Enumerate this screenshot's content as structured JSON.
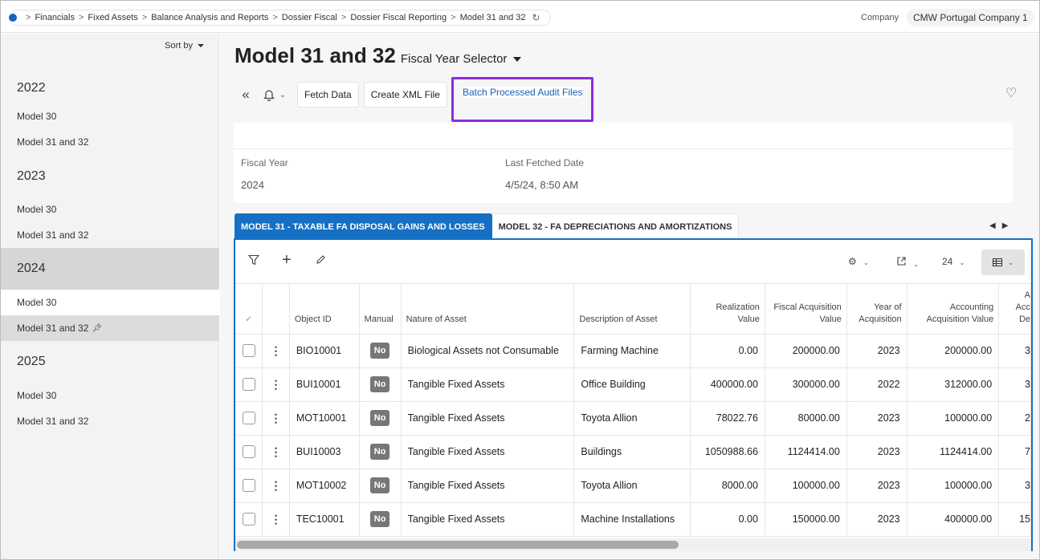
{
  "breadcrumb": {
    "items": [
      "Financials",
      "Fixed Assets",
      "Balance Analysis and Reports",
      "Dossier Fiscal",
      "Dossier Fiscal Reporting",
      "Model 31 and 32"
    ],
    "separator": ">"
  },
  "company": {
    "label": "Company",
    "value": "CMW Portugal Company 1"
  },
  "nav": {
    "sort_label": "Sort by",
    "groups": [
      {
        "year": "2022",
        "items": [
          "Model 30",
          "Model 31 and 32"
        ]
      },
      {
        "year": "2023",
        "items": [
          "Model 30",
          "Model 31 and 32"
        ]
      },
      {
        "year": "2024",
        "items": [
          "Model 30",
          "Model 31 and 32"
        ]
      },
      {
        "year": "2025",
        "items": [
          "Model 30",
          "Model 31 and 32"
        ]
      }
    ],
    "selected_group": "2024",
    "selected_item": "Model 31 and 32"
  },
  "page": {
    "title": "Model 31 and 32",
    "selector_label": "Fiscal Year Selector"
  },
  "toolbar": {
    "fetch_label": "Fetch Data",
    "create_xml_label": "Create XML File",
    "batch_label": "Batch Processed Audit Files"
  },
  "header_card": {
    "fiscal_year_label": "Fiscal Year",
    "fiscal_year_value": "2024",
    "last_fetched_label": "Last Fetched Date",
    "last_fetched_value": "4/5/24, 8:50 AM"
  },
  "tabs": [
    {
      "label": "MODEL 31 - TAXABLE FA DISPOSAL GAINS AND LOSSES",
      "active": true
    },
    {
      "label": "MODEL 32 - FA DEPRECIATIONS AND AMORTIZATIONS",
      "active": false
    }
  ],
  "grid_tools": {
    "page_size": "24"
  },
  "table": {
    "columns": {
      "object_id": "Object ID",
      "manual": "Manual",
      "nature": "Nature of Asset",
      "description": "Description of Asset",
      "realization_1": "Realization",
      "realization_2": "Value",
      "fiscal_acq_1": "Fiscal Acquisition",
      "fiscal_acq_2": "Value",
      "year_acq_1": "Year of",
      "year_acq_2": "Acquisition",
      "acc_acq_1": "Accounting",
      "acc_acq_2": "Acquisition Value",
      "partial_1": "A",
      "partial_2": "Acc",
      "partial_3": "De"
    },
    "rows": [
      {
        "object_id": "BIO10001",
        "manual": "No",
        "nature": "Biological Assets not Consumable",
        "description": "Farming Machine",
        "realization": "0.00",
        "fiscal_acq": "200000.00",
        "year": "2023",
        "acc_acq": "200000.00",
        "partial": "3"
      },
      {
        "object_id": "BUI10001",
        "manual": "No",
        "nature": "Tangible Fixed Assets",
        "description": "Office Building",
        "realization": "400000.00",
        "fiscal_acq": "300000.00",
        "year": "2022",
        "acc_acq": "312000.00",
        "partial": "3"
      },
      {
        "object_id": "MOT10001",
        "manual": "No",
        "nature": "Tangible Fixed Assets",
        "description": "Toyota Allion",
        "realization": "78022.76",
        "fiscal_acq": "80000.00",
        "year": "2023",
        "acc_acq": "100000.00",
        "partial": "2"
      },
      {
        "object_id": "BUI10003",
        "manual": "No",
        "nature": "Tangible Fixed Assets",
        "description": "Buildings",
        "realization": "1050988.66",
        "fiscal_acq": "1124414.00",
        "year": "2023",
        "acc_acq": "1124414.00",
        "partial": "7"
      },
      {
        "object_id": "MOT10002",
        "manual": "No",
        "nature": "Tangible Fixed Assets",
        "description": "Toyota Allion",
        "realization": "8000.00",
        "fiscal_acq": "100000.00",
        "year": "2023",
        "acc_acq": "100000.00",
        "partial": "3"
      },
      {
        "object_id": "TEC10001",
        "manual": "No",
        "nature": "Tangible Fixed Assets",
        "description": "Machine Installations",
        "realization": "0.00",
        "fiscal_acq": "150000.00",
        "year": "2023",
        "acc_acq": "400000.00",
        "partial": "15"
      }
    ]
  },
  "colors": {
    "accent": "#1570c4",
    "highlight": "#8b2be2",
    "breadcrumb_dot": "#1565c0",
    "badge": "#777777"
  },
  "icons": [
    "filter-icon",
    "plus-icon",
    "pencil-icon",
    "gear-icon",
    "export-icon",
    "grid-view-icon",
    "bell-icon",
    "heart-icon",
    "collapse-icon",
    "refresh-icon",
    "pin-icon"
  ]
}
